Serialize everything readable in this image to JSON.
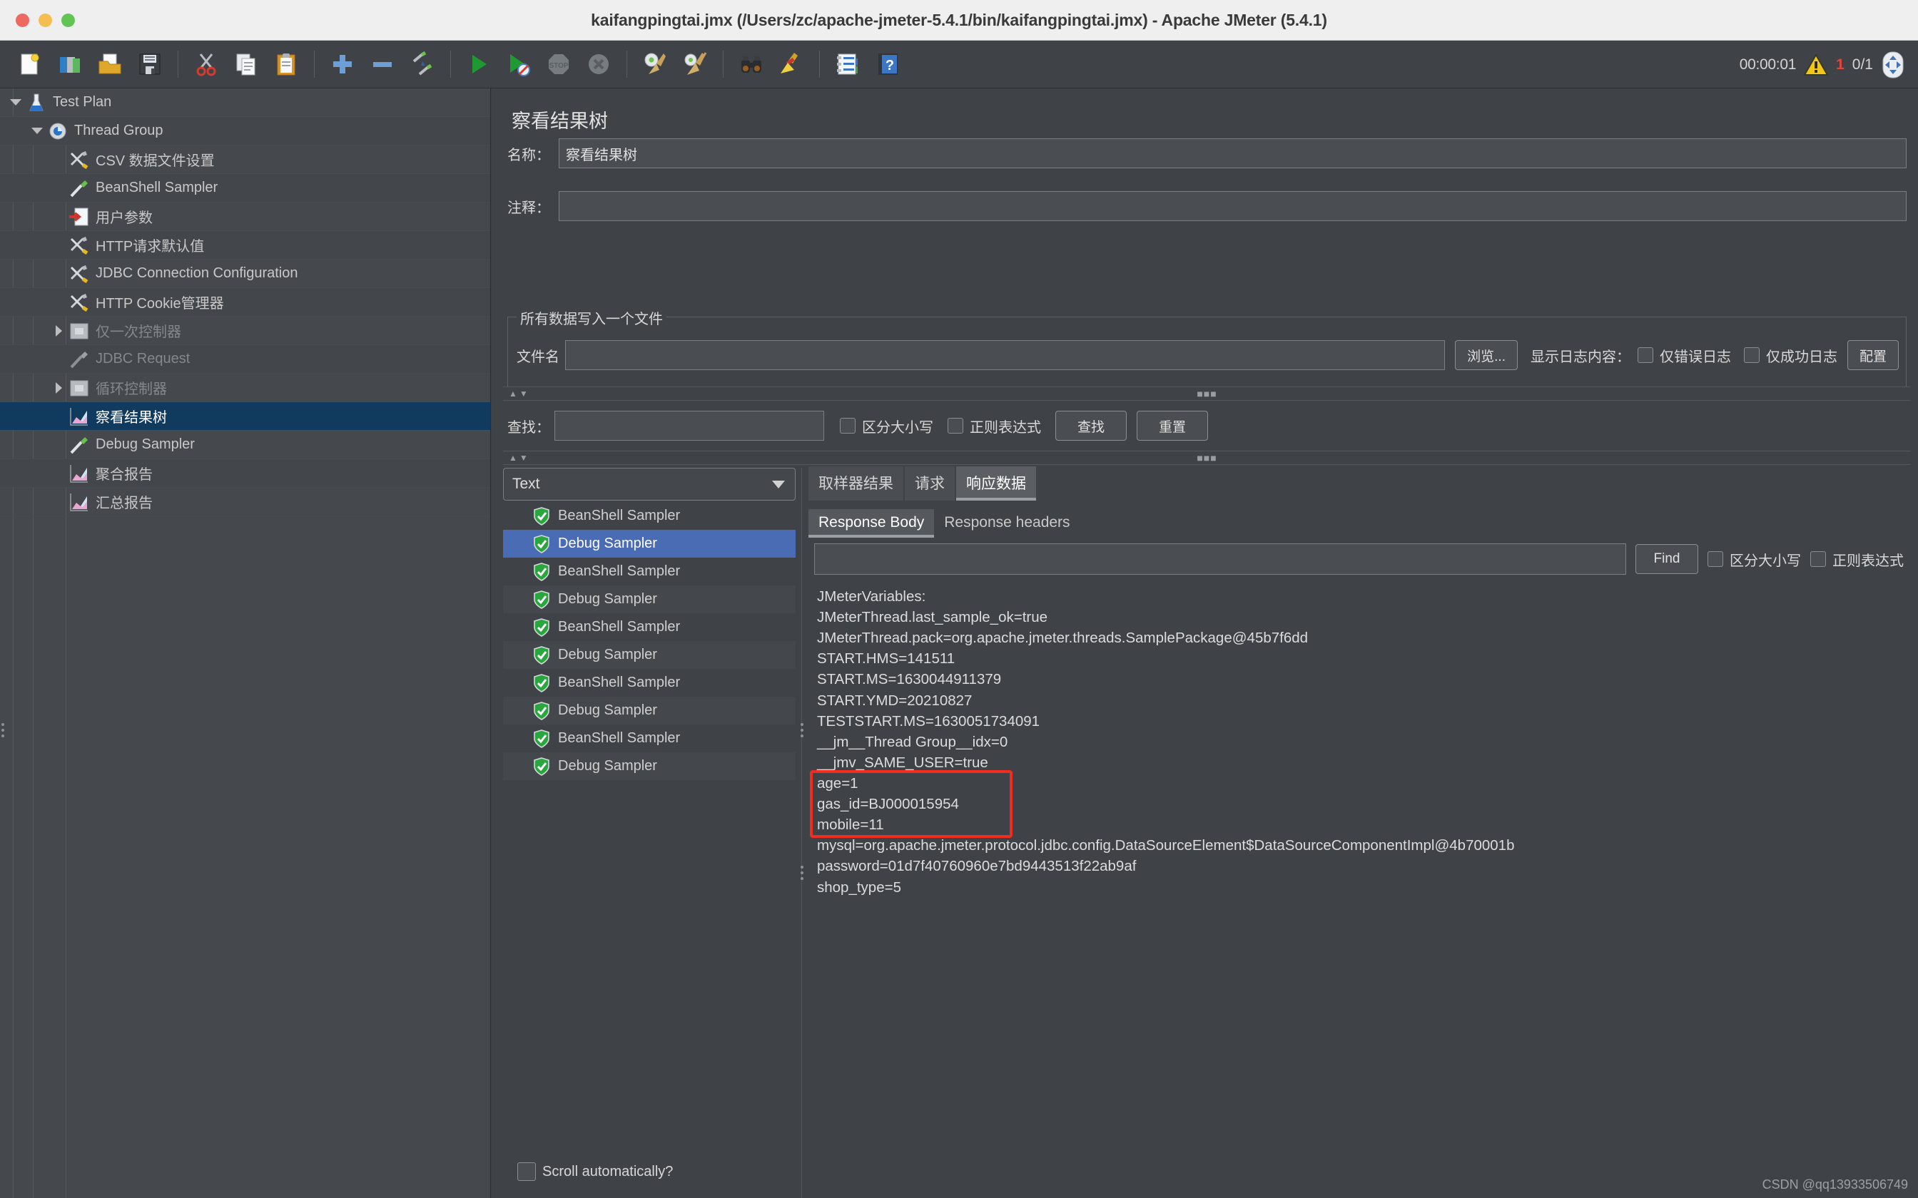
{
  "window": {
    "title": "kaifangpingtai.jmx (/Users/zc/apache-jmeter-5.4.1/bin/kaifangpingtai.jmx) - Apache JMeter (5.4.1)",
    "traffic_lights": [
      "close-red",
      "minimize-yellow",
      "maximize-green"
    ]
  },
  "toolbar": {
    "items": [
      {
        "name": "new-test-plan",
        "icon": "new-document-icon"
      },
      {
        "name": "templates",
        "icon": "templates-icon"
      },
      {
        "name": "open",
        "icon": "open-folder-icon"
      },
      {
        "name": "save",
        "icon": "save-disk-icon"
      },
      {
        "name": "cut",
        "icon": "scissors-icon"
      },
      {
        "name": "copy",
        "icon": "copy-icon"
      },
      {
        "name": "paste",
        "icon": "clipboard-icon"
      },
      {
        "name": "expand-all",
        "icon": "plus-icon"
      },
      {
        "name": "collapse-all",
        "icon": "minus-icon"
      },
      {
        "name": "toggle-enabled",
        "icon": "toggle-pencils-icon"
      },
      {
        "name": "start",
        "icon": "play-green-icon"
      },
      {
        "name": "start-no-pauses",
        "icon": "play-no-pause-icon"
      },
      {
        "name": "stop",
        "icon": "stop-sign-icon"
      },
      {
        "name": "shutdown",
        "icon": "shutdown-x-icon"
      },
      {
        "name": "clear",
        "icon": "gear-broom-icon"
      },
      {
        "name": "clear-all",
        "icon": "gear-broom-all-icon"
      },
      {
        "name": "search",
        "icon": "binoculars-icon"
      },
      {
        "name": "reset-search",
        "icon": "yellow-broom-icon"
      },
      {
        "name": "function-helper",
        "icon": "notepad-icon"
      },
      {
        "name": "help",
        "icon": "help-book-icon"
      }
    ],
    "status": {
      "elapsed": "00:00:01",
      "warning_icon": "warning-triangle-icon",
      "warning_count": "1",
      "threads": "0/1",
      "remote_icon": "remote-status-icon"
    }
  },
  "tree": {
    "items": [
      {
        "label": "Test Plan",
        "indent": 0,
        "toggle": "down",
        "icon": "flask-icon",
        "selected": false,
        "disabled": false
      },
      {
        "label": "Thread Group",
        "indent": 1,
        "toggle": "down",
        "icon": "gear-thread-icon",
        "selected": false,
        "disabled": false
      },
      {
        "label": "CSV 数据文件设置",
        "indent": 2,
        "toggle": "none",
        "icon": "config-tools-icon",
        "selected": false,
        "disabled": false
      },
      {
        "label": "BeanShell Sampler",
        "indent": 2,
        "toggle": "none",
        "icon": "pipette-green-icon",
        "selected": false,
        "disabled": false
      },
      {
        "label": "用户参数",
        "indent": 2,
        "toggle": "none",
        "icon": "user-params-icon",
        "selected": false,
        "disabled": false
      },
      {
        "label": "HTTP请求默认值",
        "indent": 2,
        "toggle": "none",
        "icon": "config-tools-icon",
        "selected": false,
        "disabled": false
      },
      {
        "label": "JDBC Connection Configuration",
        "indent": 2,
        "toggle": "none",
        "icon": "config-tools-icon",
        "selected": false,
        "disabled": false
      },
      {
        "label": "HTTP Cookie管理器",
        "indent": 2,
        "toggle": "none",
        "icon": "config-tools-icon",
        "selected": false,
        "disabled": false
      },
      {
        "label": "仅一次控制器",
        "indent": 2,
        "toggle": "right",
        "icon": "controller-icon",
        "selected": false,
        "disabled": true
      },
      {
        "label": "JDBC Request",
        "indent": 2,
        "toggle": "none",
        "icon": "pipette-grey-icon",
        "selected": false,
        "disabled": true
      },
      {
        "label": "循环控制器",
        "indent": 2,
        "toggle": "right",
        "icon": "controller-icon",
        "selected": false,
        "disabled": true
      },
      {
        "label": "察看结果树",
        "indent": 2,
        "toggle": "none",
        "icon": "chart-listener-icon",
        "selected": true,
        "disabled": false
      },
      {
        "label": "Debug Sampler",
        "indent": 2,
        "toggle": "none",
        "icon": "pipette-green-icon",
        "selected": false,
        "disabled": false
      },
      {
        "label": "聚合报告",
        "indent": 2,
        "toggle": "none",
        "icon": "chart-listener-icon",
        "selected": false,
        "disabled": false
      },
      {
        "label": "汇总报告",
        "indent": 2,
        "toggle": "none",
        "icon": "chart-listener-icon",
        "selected": false,
        "disabled": false
      }
    ]
  },
  "panel": {
    "title": "察看结果树",
    "name_label": "名称：",
    "name_value": "察看结果树",
    "comment_label": "注释：",
    "comment_value": "",
    "filegroup": {
      "legend": "所有数据写入一个文件",
      "filename_label": "文件名",
      "filename_value": "",
      "browse_button": "浏览...",
      "log_display_label": "显示日志内容：",
      "errors_only_label": "仅错误日志",
      "successes_only_label": "仅成功日志",
      "configure_button": "配置"
    },
    "search": {
      "label": "查找：",
      "value": "",
      "case_sensitive_label": "区分大小写",
      "regex_label": "正则表达式",
      "find_button": "查找",
      "reset_button": "重置"
    },
    "results": {
      "render_type": "Text",
      "render_options": [
        "Text"
      ],
      "samplers": [
        {
          "label": "BeanShell Sampler",
          "status": "success-shield-icon",
          "selected": false
        },
        {
          "label": "Debug Sampler",
          "status": "success-shield-icon",
          "selected": true
        },
        {
          "label": "BeanShell Sampler",
          "status": "success-shield-icon",
          "selected": false
        },
        {
          "label": "Debug Sampler",
          "status": "success-shield-icon",
          "selected": false
        },
        {
          "label": "BeanShell Sampler",
          "status": "success-shield-icon",
          "selected": false
        },
        {
          "label": "Debug Sampler",
          "status": "success-shield-icon",
          "selected": false
        },
        {
          "label": "BeanShell Sampler",
          "status": "success-shield-icon",
          "selected": false
        },
        {
          "label": "Debug Sampler",
          "status": "success-shield-icon",
          "selected": false
        },
        {
          "label": "BeanShell Sampler",
          "status": "success-shield-icon",
          "selected": false
        },
        {
          "label": "Debug Sampler",
          "status": "success-shield-icon",
          "selected": false
        }
      ],
      "scroll_automatically_label": "Scroll automatically?"
    },
    "detail": {
      "outer_tabs": [
        {
          "label": "取样器结果",
          "active": false
        },
        {
          "label": "请求",
          "active": false
        },
        {
          "label": "响应数据",
          "active": true
        }
      ],
      "inner_tabs": [
        {
          "label": "Response Body",
          "active": true
        },
        {
          "label": "Response headers",
          "active": false
        }
      ],
      "find": {
        "value": "",
        "find_button": "Find",
        "case_sensitive_label": "区分大小写",
        "regex_label": "正则表达式"
      },
      "response_body": "JMeterVariables:\nJMeterThread.last_sample_ok=true\nJMeterThread.pack=org.apache.jmeter.threads.SamplePackage@45b7f6dd\nSTART.HMS=141511\nSTART.MS=1630044911379\nSTART.YMD=20210827\nTESTSTART.MS=1630051734091\n__jm__Thread Group__idx=0\n__jmv_SAME_USER=true\nage=1\ngas_id=BJ000015954\nmobile=11\nmysql=org.apache.jmeter.protocol.jdbc.config.DataSourceElement$DataSourceComponentImpl@4b70001b\npassword=01d7f40760960e7bd9443513f22ab9af\nshop_type=5",
      "highlight_color": "#f22c1e"
    }
  },
  "watermark": "CSDN @qq13933506749"
}
